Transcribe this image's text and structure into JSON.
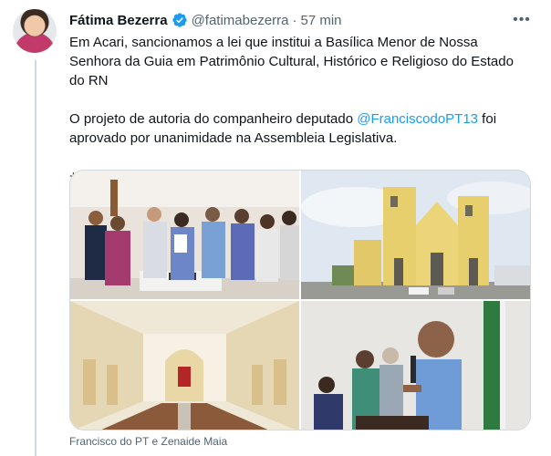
{
  "author": {
    "display_name": "Fátima Bezerra",
    "handle": "@fatimabezerra",
    "separator": "·",
    "time": "57 min",
    "verified": true
  },
  "more_label": "•••",
  "tweet": {
    "paragraph_1": "Em Acari, sancionamos a lei que institui a Basílica Menor de Nossa Senhora da Guia em Patrimônio Cultural, Histórico e Religioso do Estado do RN",
    "paragraph_2_before": "O projeto de autoria do companheiro deputado ",
    "mention": "@FranciscodoPT13",
    "paragraph_2_after": " foi aprovado por unanimidade na Assembleia Legislativa.",
    "paragraph_3": "+"
  },
  "media_caption": "Francisco do PT e Zenaide Maia",
  "colors": {
    "link": "#1d9bf0",
    "verified": "#1d9bf0",
    "secondary_text": "#536471",
    "thread_line": "#cfd9de"
  }
}
